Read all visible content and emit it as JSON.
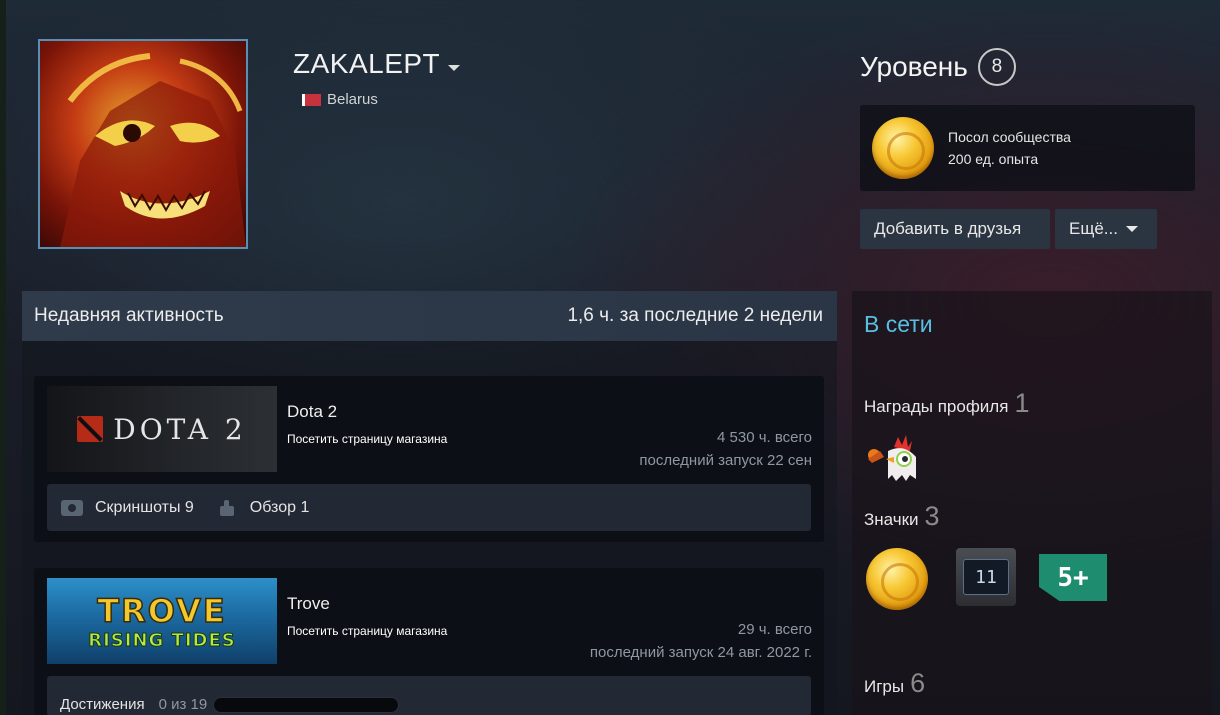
{
  "profile": {
    "persona_name": "ZAKALEPT",
    "country": "Belarus"
  },
  "level": {
    "label": "Уровень",
    "value": "8"
  },
  "favorite_badge": {
    "name": "Посол сообщества",
    "xp": "200 ед. опыта"
  },
  "actions": {
    "add_friend": "Добавить в друзья",
    "more": "Ещё..."
  },
  "activity": {
    "title": "Недавняя активность",
    "hours_summary": "1,6 ч. за последние 2 недели",
    "store_link_label": "Посетить страницу магазина",
    "games": [
      {
        "name": "Dota 2",
        "capsule_text": "DOTA 2",
        "total": "4 530 ч. всего",
        "last_played": "последний запуск 22 сен",
        "screenshots": "Скриншоты 9",
        "review": "Обзор 1"
      },
      {
        "name": "Trove",
        "capsule_title": "TROVE",
        "capsule_subtitle": "RISING TIDES",
        "total": "29 ч. всего",
        "last_played": "последний запуск 24 авг. 2022 г.",
        "achievements_label": "Достижения",
        "achievements_count": "0 из 19",
        "achievements_progress": 0.0
      }
    ]
  },
  "sidebar": {
    "status": "В сети",
    "awards": {
      "label": "Награды профиля",
      "count": "1"
    },
    "badges": {
      "label": "Значки",
      "count": "3",
      "years_value": "11",
      "five_plus": "5+"
    },
    "games": {
      "label": "Игры",
      "count": "6"
    }
  },
  "colors": {
    "online": "#58bfe3",
    "button_bg": "#2b3441",
    "flag_red": "#c8313e",
    "flag_green": "#4aa657"
  },
  "icons": [
    "caret-down-icon",
    "belarus-flag-icon",
    "community-ambassador-badge-icon",
    "camera-icon",
    "thumbs-up-icon",
    "rooster-award-icon",
    "years-of-service-badge-icon",
    "five-plus-badge-icon"
  ]
}
